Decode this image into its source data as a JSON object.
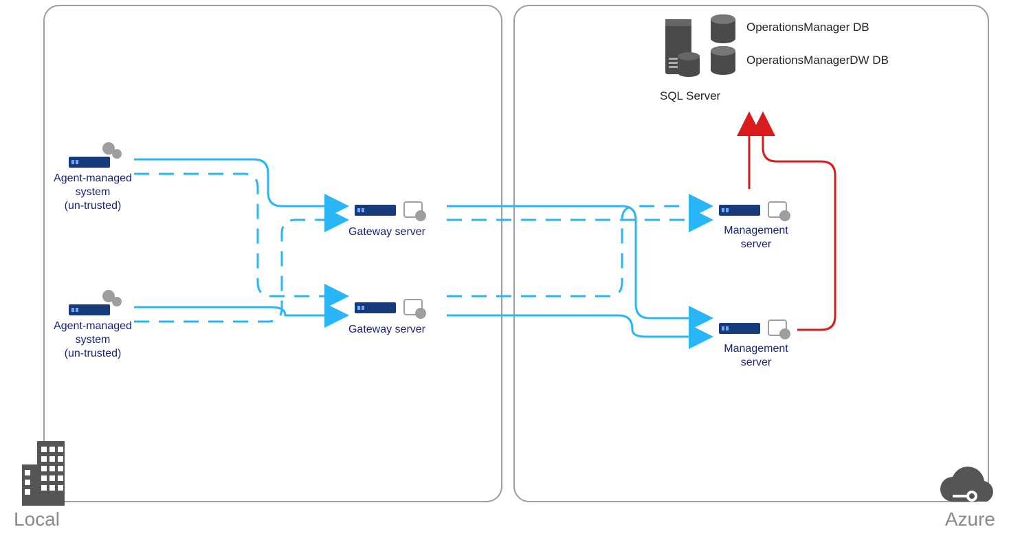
{
  "regions": {
    "local": "Local",
    "azure": "Azure"
  },
  "nodes": {
    "agent1": {
      "label": "Agent-managed\nsystem\n(un-trusted)"
    },
    "agent2": {
      "label": "Agent-managed\nsystem\n(un-trusted)"
    },
    "gateway1": {
      "label": "Gateway server"
    },
    "gateway2": {
      "label": "Gateway server"
    },
    "mgmt1": {
      "label": "Management\nserver"
    },
    "mgmt2": {
      "label": "Management\nserver"
    },
    "sql": {
      "label": "SQL Server"
    },
    "db1": {
      "label": "OperationsManager DB"
    },
    "db2": {
      "label": "OperationsManagerDW DB"
    }
  },
  "flows": {
    "agent_to_gateway": "solid primary + dashed failover (blue)",
    "gateway_to_mgmt": "solid primary + dashed failover (blue)",
    "mgmt_to_sql": "solid (red)"
  },
  "icons": {
    "building": "building-icon",
    "cloud": "cloud-icon",
    "server": "server-bar-icon",
    "gear": "gear-icon",
    "cert": "certificate-badge-icon",
    "db": "database-cylinder-icon"
  }
}
